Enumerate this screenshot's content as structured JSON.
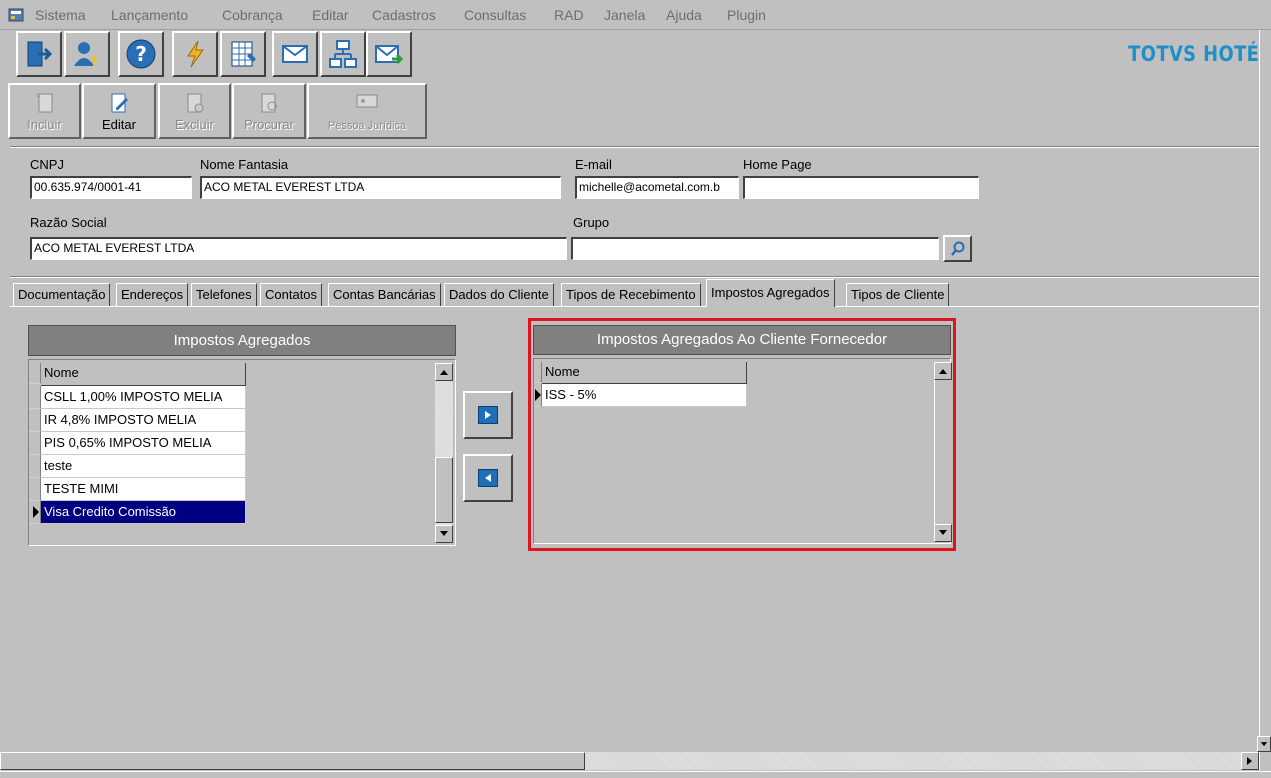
{
  "menu": [
    "Sistema",
    "Lançamento",
    "Cobrança",
    "Editar",
    "Cadastros",
    "Consultas",
    "RAD",
    "Janela",
    "Ajuda",
    "Plugin"
  ],
  "toolbar": {
    "icons": [
      "exit-icon",
      "user-key-icon",
      "help-icon",
      "lightning-icon",
      "calculator-icon",
      "mail-icon",
      "network-icon",
      "mail-send-icon"
    ],
    "brand": "TOTVS HOTÉ"
  },
  "actions": {
    "incluir": "Incluir",
    "editar": "Editar",
    "excluir": "Excluir",
    "procurar": "Procurar",
    "pessoa_juridica": "Pessoa Jurídica"
  },
  "form": {
    "cnpj_label": "CNPJ",
    "cnpj_value": "00.635.974/0001-41",
    "nome_fantasia_label": "Nome Fantasia",
    "nome_fantasia_value": "ACO METAL EVEREST LTDA",
    "email_label": "E-mail",
    "email_value": "michelle@acometal.com.b",
    "homepage_label": "Home Page",
    "homepage_value": "",
    "razao_social_label": "Razão Social",
    "razao_social_value": "ACO METAL EVEREST LTDA",
    "grupo_label": "Grupo",
    "grupo_value": ""
  },
  "tabs": [
    "Documentação",
    "Endereços",
    "Telefones",
    "Contatos",
    "Contas Bancárias",
    "Dados do Cliente",
    "Tipos de Recebimento",
    "Impostos Agregados",
    "Tipos de Cliente"
  ],
  "active_tab": "Impostos Agregados",
  "left_grid": {
    "title": "Impostos Agregados",
    "column": "Nome",
    "rows": [
      "CSLL 1,00% IMPOSTO MELIA",
      "IR 4,8% IMPOSTO MELIA",
      "PIS 0,65% IMPOSTO MELIA",
      "teste",
      "TESTE MIMI",
      "Visa Credito Comissão"
    ],
    "selected": "Visa Credito Comissão"
  },
  "right_grid": {
    "title": "Impostos Agregados Ao Cliente Fornecedor",
    "column": "Nome",
    "rows": [
      "ISS - 5%"
    ]
  },
  "colors": {
    "highlight": "#e0141e",
    "selection": "#000080",
    "brand": "#1e8fc8"
  }
}
